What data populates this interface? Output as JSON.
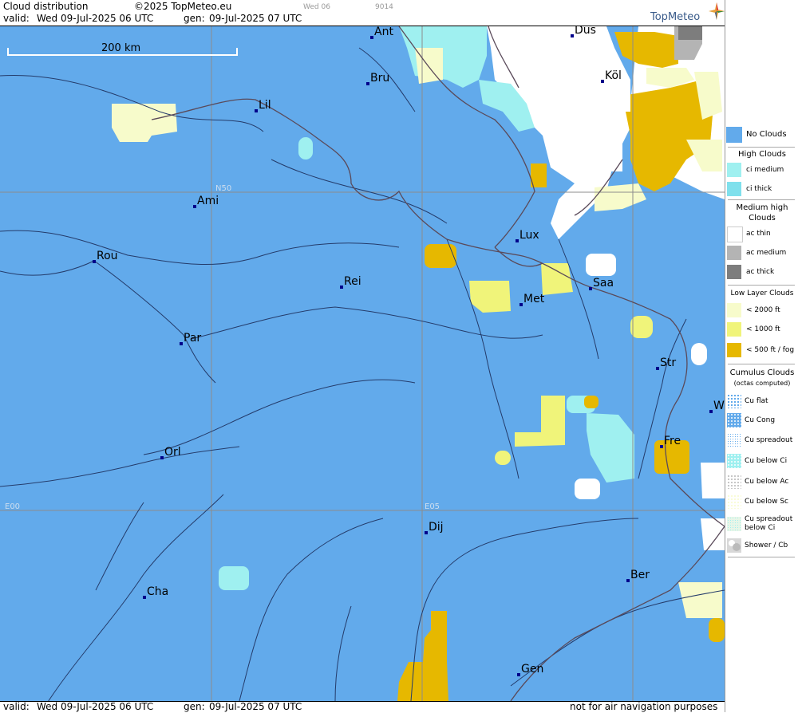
{
  "header": {
    "title": "Cloud distribution",
    "copyright": "©2025 TopMeteo.eu",
    "valid_label": "valid:",
    "valid_value": "Wed  09-Jul-2025  06 UTC",
    "gen_label": "gen:",
    "gen_value": "09-Jul-2025 07 UTC",
    "tag1": "Wed 06",
    "tag2": "9014",
    "logo": "TopMeteo"
  },
  "map": {
    "scale_label": "200 km",
    "grid_labels": {
      "n50": "N50",
      "e00": "E00",
      "e05": "E05"
    },
    "cities": [
      {
        "name": "Ant"
      },
      {
        "name": "Düs"
      },
      {
        "name": "Bru"
      },
      {
        "name": "Köl"
      },
      {
        "name": "Lil"
      },
      {
        "name": "Ami"
      },
      {
        "name": "Rou"
      },
      {
        "name": "Lux"
      },
      {
        "name": "Rei"
      },
      {
        "name": "Saa"
      },
      {
        "name": "Met"
      },
      {
        "name": "Par"
      },
      {
        "name": "Str"
      },
      {
        "name": "W"
      },
      {
        "name": "Fre"
      },
      {
        "name": "Orl"
      },
      {
        "name": "Dij"
      },
      {
        "name": "Ber"
      },
      {
        "name": "Cha"
      },
      {
        "name": "Gen"
      }
    ]
  },
  "footer": {
    "valid_label": "valid:",
    "valid_value": "Wed  09-Jul-2025  06 UTC",
    "gen_label": "gen:",
    "gen_value": "09-Jul-2025 07 UTC",
    "disclaimer": "not for air navigation purposes"
  },
  "legend": {
    "no_clouds": "No Clouds",
    "high_head": "High Clouds",
    "ci_medium": "ci medium",
    "ci_thick": "ci thick",
    "medium_head_1": "Medium high",
    "medium_head_2": "Clouds",
    "ac_thin": "ac thin",
    "ac_medium": "ac medium",
    "ac_thick": "ac thick",
    "low_head": "Low Layer Clouds",
    "low_2000": "< 2000 ft",
    "low_1000": "< 1000 ft",
    "low_500": "< 500 ft / fog",
    "cu_head_1": "Cumulus Clouds",
    "cu_head_2": "(octas computed)",
    "cu_flat": "Cu flat",
    "cu_cong": "Cu Cong",
    "cu_spread": "Cu spreadout",
    "cu_below_ci": "Cu below Ci",
    "cu_below_ac": "Cu below Ac",
    "cu_below_sc": "Cu below Sc",
    "cu_spread_ci_1": "Cu spreadout",
    "cu_spread_ci_2": "below Ci",
    "shower": "Shower / Cb"
  },
  "colors": {
    "no_clouds": "#62aaeb",
    "ci": "#9ff0f0",
    "ac_thin": "#ffffff",
    "ac_medium": "#b4b4b4",
    "ac_thick": "#7d7d7d",
    "low_2000": "#f7fbcb",
    "low_1000": "#f0f47a",
    "low_500": "#e6b800"
  }
}
